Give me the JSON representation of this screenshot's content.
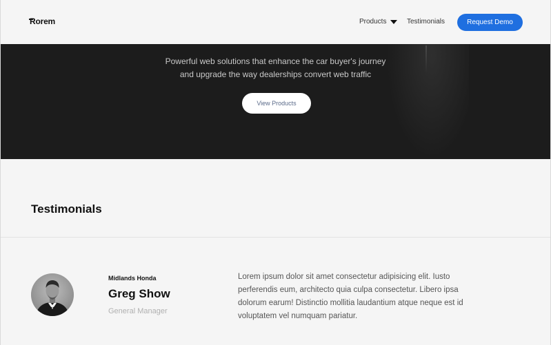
{
  "header": {
    "logo": "Rorem",
    "nav": {
      "products_label": "Products",
      "testimonials_label": "Testimonials"
    },
    "cta_label": "Request Demo",
    "cta_color": "#1f6fe0"
  },
  "hero": {
    "line1": "Powerful web solutions that enhance the car buyer's journey",
    "line2": "and upgrade the way dealerships convert web traffic",
    "button_label": "View Products",
    "background_color": "#1c1c1c"
  },
  "testimonials": {
    "heading": "Testimonials",
    "items": [
      {
        "company": "Midlands Honda",
        "name": "Greg Show",
        "role": "General Manager",
        "quote": "Lorem ipsum dolor sit amet consectetur adipisicing elit. Iusto perferendis eum, architecto quia culpa consectetur. Libero ipsa dolorum earum! Distinctio mollitia laudantium atque neque est id voluptatem vel numquam pariatur."
      }
    ]
  }
}
